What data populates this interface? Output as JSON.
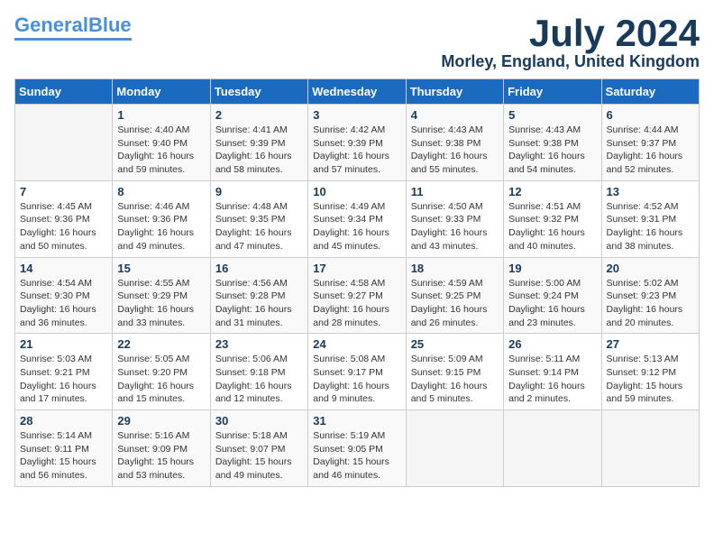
{
  "header": {
    "logo_line1": "General",
    "logo_line2": "Blue",
    "month_title": "July 2024",
    "location": "Morley, England, United Kingdom"
  },
  "weekdays": [
    "Sunday",
    "Monday",
    "Tuesday",
    "Wednesday",
    "Thursday",
    "Friday",
    "Saturday"
  ],
  "weeks": [
    [
      {
        "day": "",
        "info": ""
      },
      {
        "day": "1",
        "info": "Sunrise: 4:40 AM\nSunset: 9:40 PM\nDaylight: 16 hours\nand 59 minutes."
      },
      {
        "day": "2",
        "info": "Sunrise: 4:41 AM\nSunset: 9:39 PM\nDaylight: 16 hours\nand 58 minutes."
      },
      {
        "day": "3",
        "info": "Sunrise: 4:42 AM\nSunset: 9:39 PM\nDaylight: 16 hours\nand 57 minutes."
      },
      {
        "day": "4",
        "info": "Sunrise: 4:43 AM\nSunset: 9:38 PM\nDaylight: 16 hours\nand 55 minutes."
      },
      {
        "day": "5",
        "info": "Sunrise: 4:43 AM\nSunset: 9:38 PM\nDaylight: 16 hours\nand 54 minutes."
      },
      {
        "day": "6",
        "info": "Sunrise: 4:44 AM\nSunset: 9:37 PM\nDaylight: 16 hours\nand 52 minutes."
      }
    ],
    [
      {
        "day": "7",
        "info": "Sunrise: 4:45 AM\nSunset: 9:36 PM\nDaylight: 16 hours\nand 50 minutes."
      },
      {
        "day": "8",
        "info": "Sunrise: 4:46 AM\nSunset: 9:36 PM\nDaylight: 16 hours\nand 49 minutes."
      },
      {
        "day": "9",
        "info": "Sunrise: 4:48 AM\nSunset: 9:35 PM\nDaylight: 16 hours\nand 47 minutes."
      },
      {
        "day": "10",
        "info": "Sunrise: 4:49 AM\nSunset: 9:34 PM\nDaylight: 16 hours\nand 45 minutes."
      },
      {
        "day": "11",
        "info": "Sunrise: 4:50 AM\nSunset: 9:33 PM\nDaylight: 16 hours\nand 43 minutes."
      },
      {
        "day": "12",
        "info": "Sunrise: 4:51 AM\nSunset: 9:32 PM\nDaylight: 16 hours\nand 40 minutes."
      },
      {
        "day": "13",
        "info": "Sunrise: 4:52 AM\nSunset: 9:31 PM\nDaylight: 16 hours\nand 38 minutes."
      }
    ],
    [
      {
        "day": "14",
        "info": "Sunrise: 4:54 AM\nSunset: 9:30 PM\nDaylight: 16 hours\nand 36 minutes."
      },
      {
        "day": "15",
        "info": "Sunrise: 4:55 AM\nSunset: 9:29 PM\nDaylight: 16 hours\nand 33 minutes."
      },
      {
        "day": "16",
        "info": "Sunrise: 4:56 AM\nSunset: 9:28 PM\nDaylight: 16 hours\nand 31 minutes."
      },
      {
        "day": "17",
        "info": "Sunrise: 4:58 AM\nSunset: 9:27 PM\nDaylight: 16 hours\nand 28 minutes."
      },
      {
        "day": "18",
        "info": "Sunrise: 4:59 AM\nSunset: 9:25 PM\nDaylight: 16 hours\nand 26 minutes."
      },
      {
        "day": "19",
        "info": "Sunrise: 5:00 AM\nSunset: 9:24 PM\nDaylight: 16 hours\nand 23 minutes."
      },
      {
        "day": "20",
        "info": "Sunrise: 5:02 AM\nSunset: 9:23 PM\nDaylight: 16 hours\nand 20 minutes."
      }
    ],
    [
      {
        "day": "21",
        "info": "Sunrise: 5:03 AM\nSunset: 9:21 PM\nDaylight: 16 hours\nand 17 minutes."
      },
      {
        "day": "22",
        "info": "Sunrise: 5:05 AM\nSunset: 9:20 PM\nDaylight: 16 hours\nand 15 minutes."
      },
      {
        "day": "23",
        "info": "Sunrise: 5:06 AM\nSunset: 9:18 PM\nDaylight: 16 hours\nand 12 minutes."
      },
      {
        "day": "24",
        "info": "Sunrise: 5:08 AM\nSunset: 9:17 PM\nDaylight: 16 hours\nand 9 minutes."
      },
      {
        "day": "25",
        "info": "Sunrise: 5:09 AM\nSunset: 9:15 PM\nDaylight: 16 hours\nand 5 minutes."
      },
      {
        "day": "26",
        "info": "Sunrise: 5:11 AM\nSunset: 9:14 PM\nDaylight: 16 hours\nand 2 minutes."
      },
      {
        "day": "27",
        "info": "Sunrise: 5:13 AM\nSunset: 9:12 PM\nDaylight: 15 hours\nand 59 minutes."
      }
    ],
    [
      {
        "day": "28",
        "info": "Sunrise: 5:14 AM\nSunset: 9:11 PM\nDaylight: 15 hours\nand 56 minutes."
      },
      {
        "day": "29",
        "info": "Sunrise: 5:16 AM\nSunset: 9:09 PM\nDaylight: 15 hours\nand 53 minutes."
      },
      {
        "day": "30",
        "info": "Sunrise: 5:18 AM\nSunset: 9:07 PM\nDaylight: 15 hours\nand 49 minutes."
      },
      {
        "day": "31",
        "info": "Sunrise: 5:19 AM\nSunset: 9:05 PM\nDaylight: 15 hours\nand 46 minutes."
      },
      {
        "day": "",
        "info": ""
      },
      {
        "day": "",
        "info": ""
      },
      {
        "day": "",
        "info": ""
      }
    ]
  ]
}
